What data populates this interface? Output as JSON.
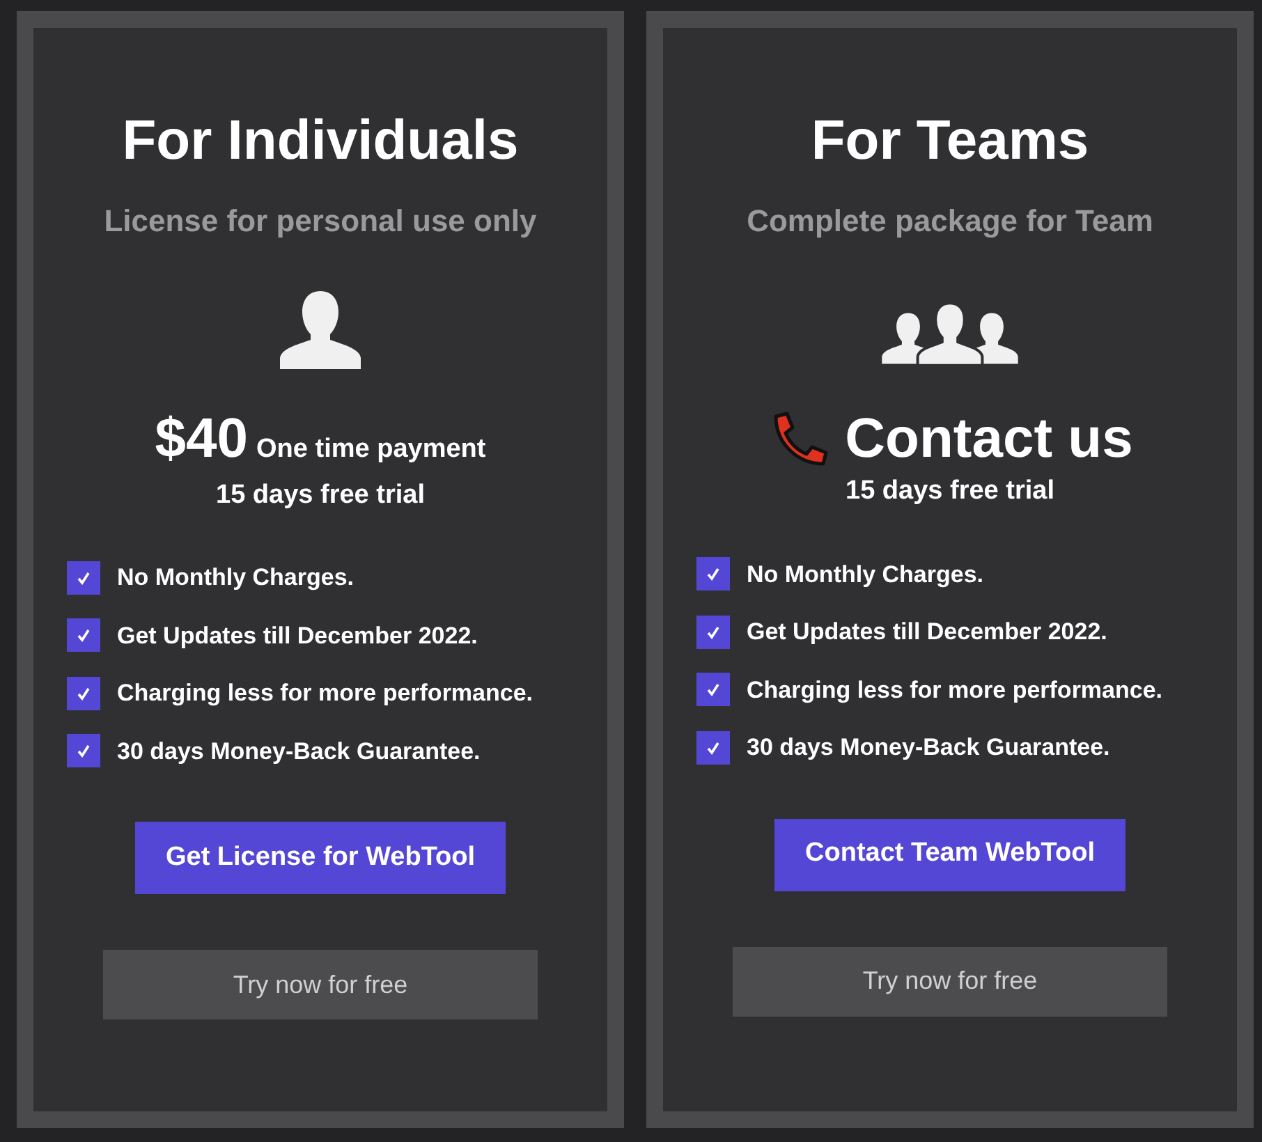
{
  "plans": [
    {
      "kind": "individual",
      "title": "For Individuals",
      "subtitle": "License for personal use only",
      "price": {
        "kind": "price",
        "amount": "$40",
        "note": "One time payment"
      },
      "trial": "15 days free trial",
      "features": [
        {
          "text": "No Monthly Charges.",
          "checked": true
        },
        {
          "text": "Get Updates till December 2022.",
          "checked": true
        },
        {
          "text": "Charging less for more performance.",
          "checked": true
        },
        {
          "text": "30 days Money-Back Guarantee.",
          "checked": true
        }
      ],
      "primary_button": "Get License for WebTool",
      "secondary_button": "Try now for free"
    },
    {
      "kind": "team",
      "title": "For Teams",
      "subtitle": "Complete package for Team",
      "price": {
        "kind": "contact",
        "amount": "Contact us"
      },
      "trial": "15 days free trial",
      "features": [
        {
          "text": "No Monthly Charges.",
          "checked": true
        },
        {
          "text": "Get Updates till December 2022.",
          "checked": true
        },
        {
          "text": "Charging less for more performance.",
          "checked": true
        },
        {
          "text": "30 days Money-Back Guarantee.",
          "checked": true
        }
      ],
      "primary_button": "Contact Team WebTool",
      "secondary_button": "Try now for free"
    }
  ]
}
